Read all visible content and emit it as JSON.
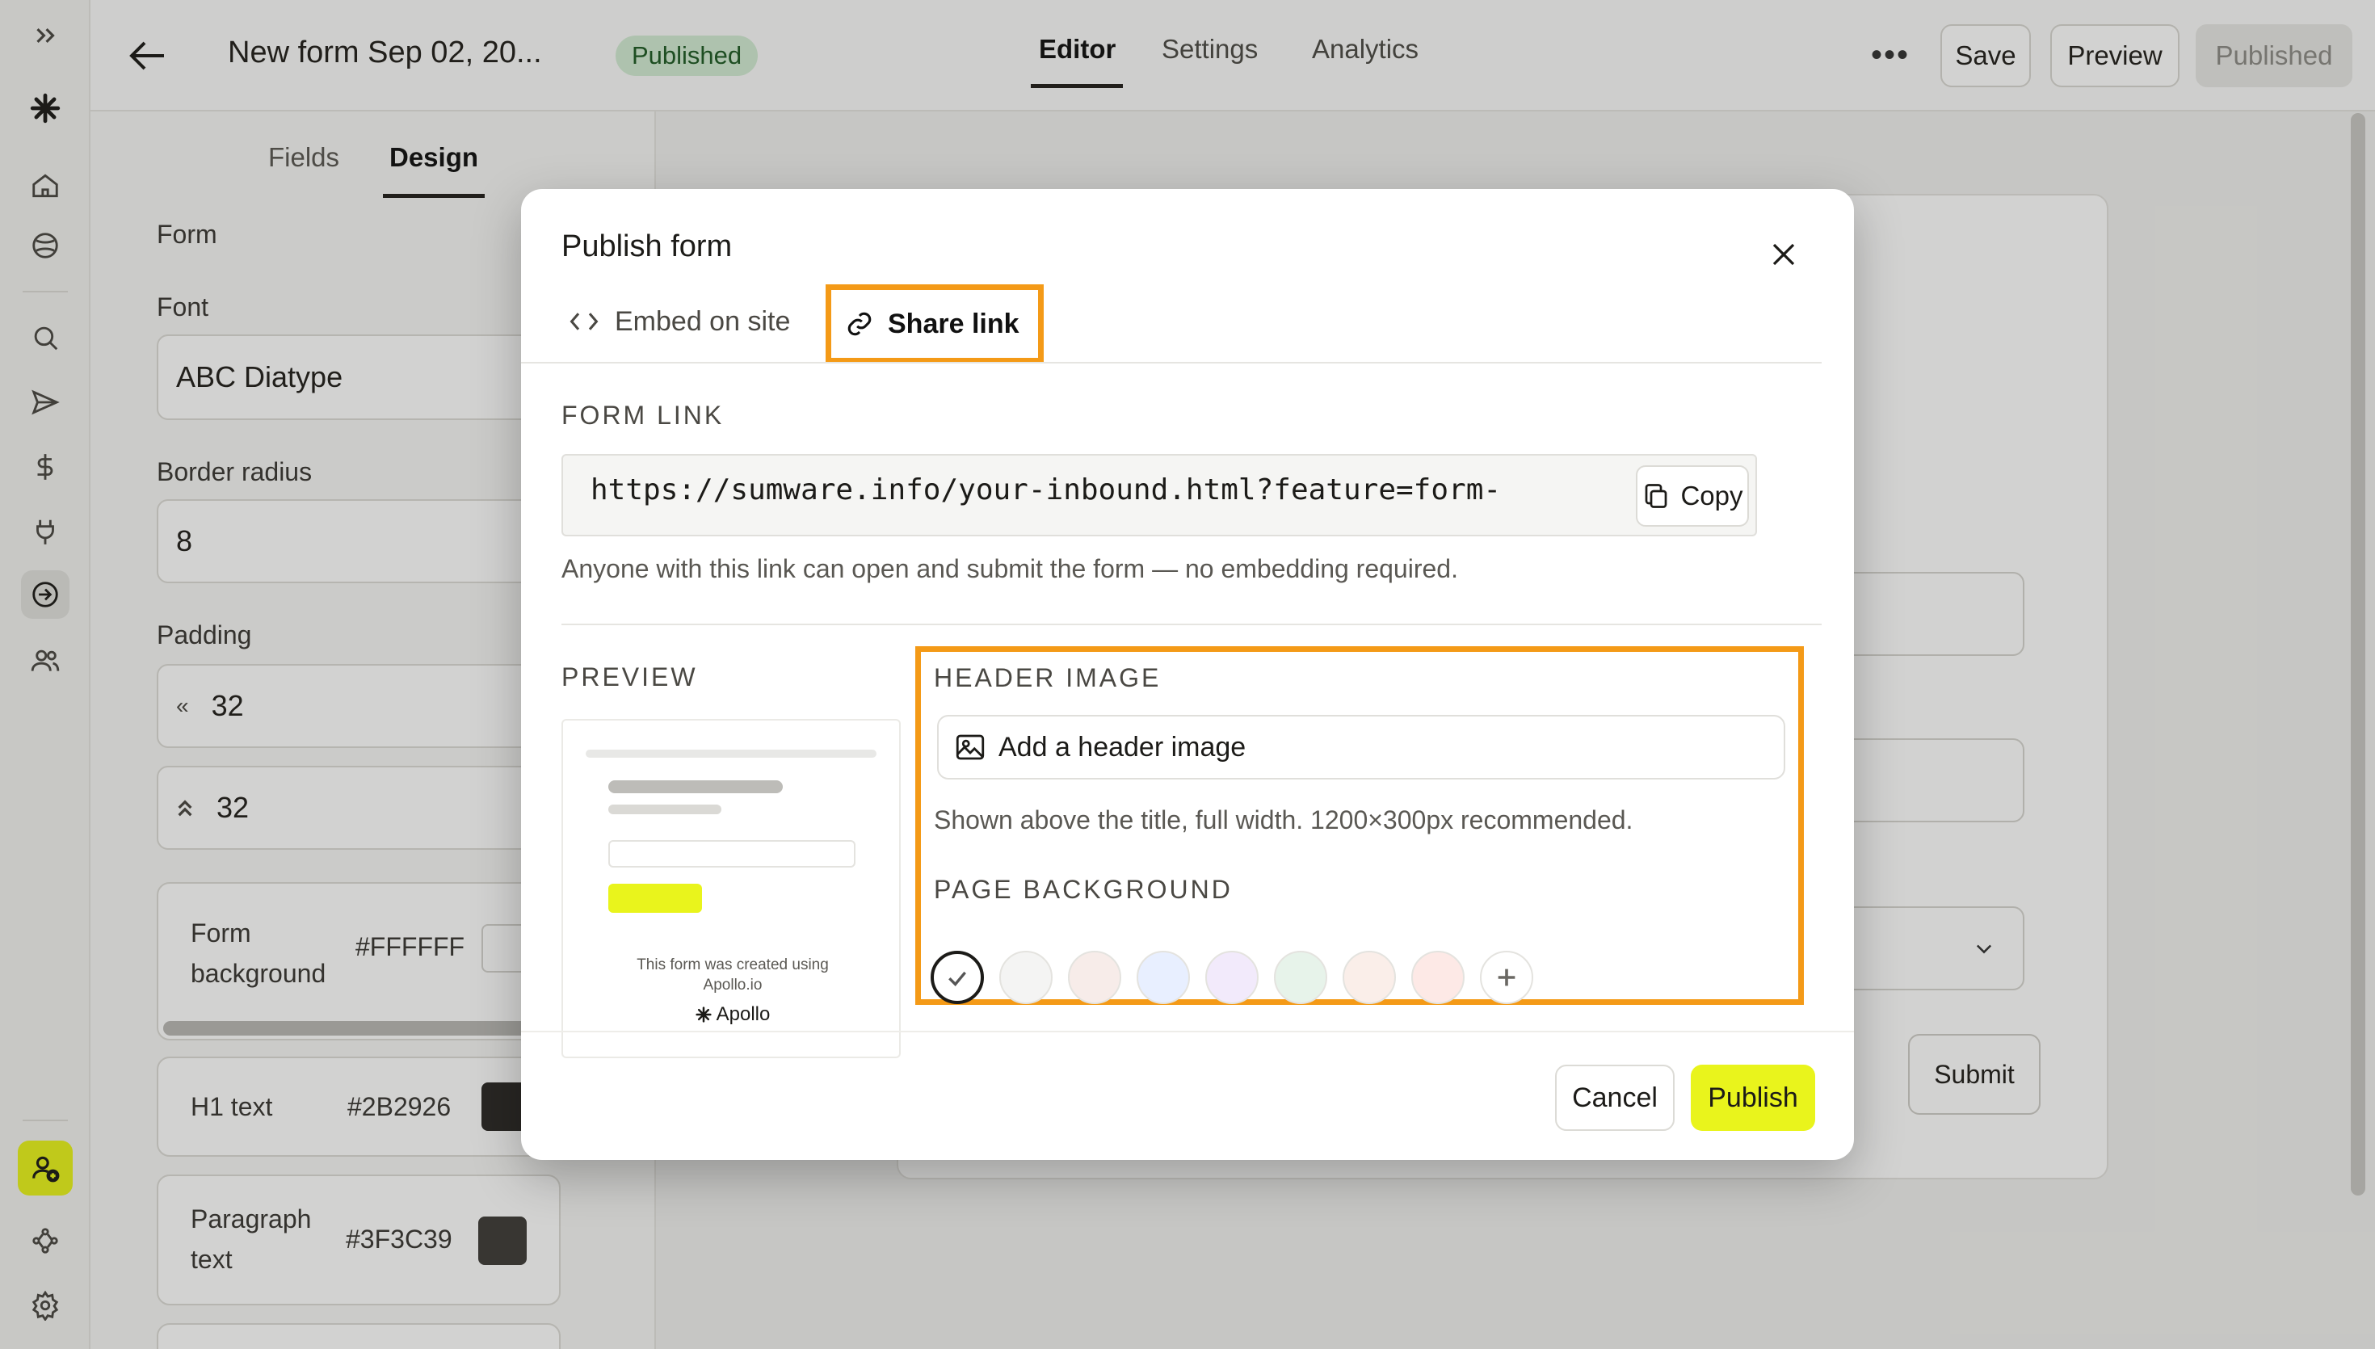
{
  "topbar": {
    "title": "New form Sep 02, 20...",
    "status": "Published",
    "tabs": [
      "Editor",
      "Settings",
      "Analytics"
    ],
    "save": "Save",
    "preview": "Preview",
    "published": "Published"
  },
  "left_panel": {
    "tabs": [
      "Fields",
      "Design"
    ],
    "section": "Form",
    "font_label": "Font",
    "font_value": "ABC Diatype",
    "radius_label": "Border radius",
    "radius_value": "8",
    "padding_label": "Padding",
    "padding_h": "32",
    "padding_v": "32",
    "form_bg_label_1": "Form",
    "form_bg_label_2": "background",
    "form_bg_value": "#FFFFFF",
    "h1_label": "H1 text",
    "h1_value": "#2B2926",
    "para_label_1": "Paragraph",
    "para_label_2": "text",
    "para_value": "#3F3C39"
  },
  "canvas": {
    "submit": "Submit"
  },
  "modal": {
    "title": "Publish form",
    "tabs": [
      "Embed on site",
      "Share link"
    ],
    "active_tab": "Share link",
    "form_link_label": "FORM LINK",
    "link": "https://sumware.info/your-inbound.html?feature=form-",
    "copy": "Copy",
    "help": "Anyone with this link can open and submit the form — no embedding required.",
    "preview_label": "PREVIEW",
    "preview_footer_1": "This form was created using",
    "preview_footer_2": "Apollo.io",
    "preview_brand": "Apollo",
    "header_image_label": "HEADER IMAGE",
    "add_header": "Add a header image",
    "header_help": "Shown above the title, full width. 1200×300px recommended.",
    "bg_label": "PAGE BACKGROUND",
    "bg_colors": [
      "#ffffff",
      "#f4f4f3",
      "#f7ece9",
      "#e8efff",
      "#f2eafb",
      "#e7f3ea",
      "#faeee9",
      "#fde9e6"
    ],
    "selected_bg": 0,
    "cancel": "Cancel",
    "publish": "Publish"
  },
  "colors": {
    "accent": "#e9f41c",
    "highlight": "#f49a17",
    "badge_bg": "#d3ecd4"
  }
}
